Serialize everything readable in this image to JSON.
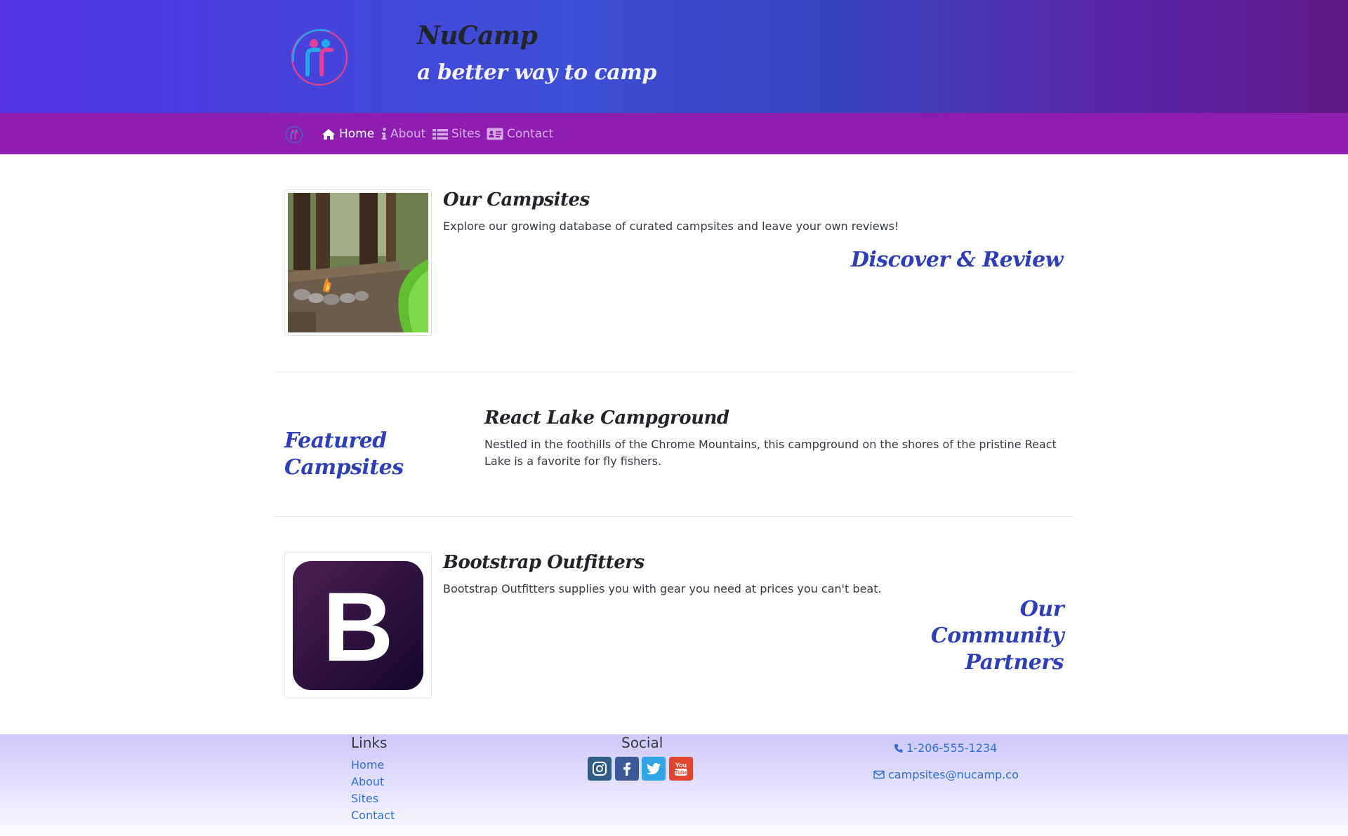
{
  "header": {
    "title": "NuCamp",
    "tagline": "a better way to camp",
    "logo_icon": "nucamp-logo-icon"
  },
  "nav": {
    "items": [
      {
        "label": "Home",
        "icon": "home-icon",
        "active": true
      },
      {
        "label": "About",
        "icon": "info-icon",
        "active": false
      },
      {
        "label": "Sites",
        "icon": "list-icon",
        "active": false
      },
      {
        "label": "Contact",
        "icon": "address-card-icon",
        "active": false
      }
    ]
  },
  "campsites": {
    "heading": "Our Campsites",
    "text": "Explore our growing database of curated campsites and leave your own reviews!",
    "accent": "Discover & Review"
  },
  "featured": {
    "accent": "Featured Campsites",
    "heading": "React Lake Campground",
    "text": "Nestled in the foothills of the Chrome Mountains, this campground on the shores of the pristine React Lake is a favorite for fly fishers."
  },
  "partners": {
    "heading": "Bootstrap Outfitters",
    "text": "Bootstrap Outfitters supplies you with gear you need at prices you can't beat.",
    "accent": "Our Community Partners",
    "logo_letter": "B"
  },
  "footer": {
    "links_heading": "Links",
    "links": [
      "Home",
      "About",
      "Sites",
      "Contact"
    ],
    "social_heading": "Social",
    "social": [
      "instagram-icon",
      "facebook-icon",
      "twitter-icon",
      "youtube-icon"
    ],
    "phone": "1-206-555-1234",
    "email": "campsites@nucamp.co"
  },
  "colors": {
    "nav_background": "#8e1eb0",
    "accent_text": "#2e3eb8",
    "link": "#2f6fd6"
  }
}
